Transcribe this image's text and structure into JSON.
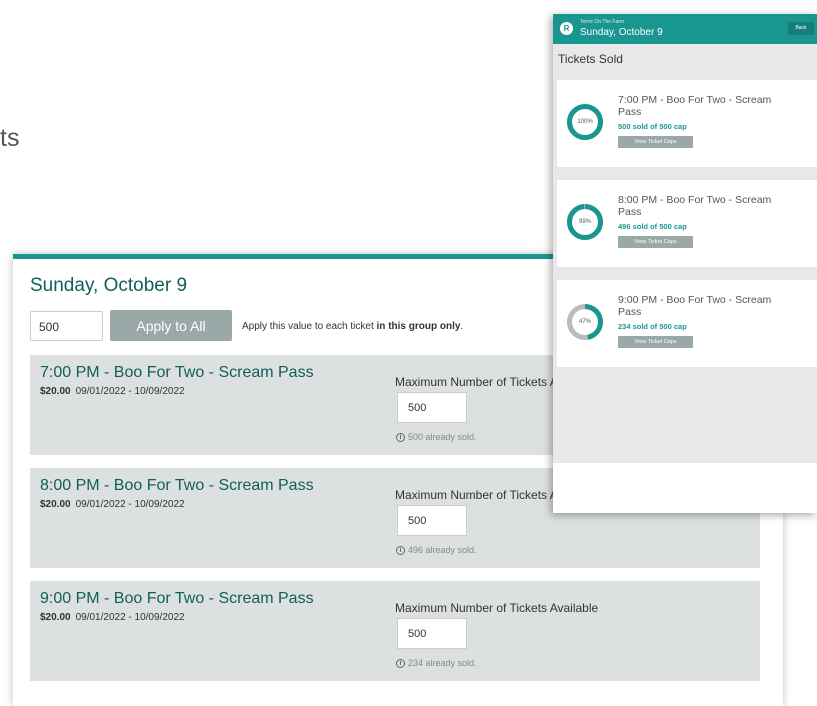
{
  "background_text": "ts",
  "desktop": {
    "title": "Sunday, October 9",
    "group_value": "500",
    "apply_label": "Apply to All",
    "apply_note_prefix": "Apply this value to each ticket ",
    "apply_note_bold": "in this group only",
    "apply_note_suffix": ".",
    "tickets": [
      {
        "name": "7:00 PM - Boo For Two - Scream Pass",
        "price": "$20.00",
        "dates": "09/01/2022 - 10/09/2022",
        "max_label": "Maximum Number of Tickets Available",
        "max_value": "500",
        "sold_note": "500 already sold."
      },
      {
        "name": "8:00 PM - Boo For Two - Scream Pass",
        "price": "$20.00",
        "dates": "09/01/2022 - 10/09/2022",
        "max_label": "Maximum Number of Tickets Available",
        "max_value": "500",
        "sold_note": "496 already sold."
      },
      {
        "name": "9:00 PM - Boo For Two - Scream Pass",
        "price": "$20.00",
        "dates": "09/01/2022 - 10/09/2022",
        "max_label": "Maximum Number of Tickets Available",
        "max_value": "500",
        "sold_note": "234 already sold."
      }
    ]
  },
  "mobile": {
    "logo_letter": "R",
    "subtitle": "Terror On The Farm",
    "title": "Sunday, October 9",
    "back_label": "Back",
    "section_title": "Tickets Sold",
    "cards": [
      {
        "percent": 100,
        "percent_label": "100%",
        "line1": "7:00 PM - Boo For Two - Scream",
        "line2": "Pass",
        "sold": "500 sold of 500 cap",
        "caps_label": "View Ticket Caps"
      },
      {
        "percent": 99,
        "percent_label": "99%",
        "line1": "8:00 PM - Boo For Two - Scream",
        "line2": "Pass",
        "sold": "496 sold of 500 cap",
        "caps_label": "View Ticket Caps"
      },
      {
        "percent": 47,
        "percent_label": "47%",
        "line1": "9:00 PM - Boo For Two - Scream",
        "line2": "Pass",
        "sold": "234 sold of 500 cap",
        "caps_label": "View Ticket Caps"
      }
    ]
  },
  "colors": {
    "accent": "#1a9690",
    "ring_track": "#b9bcbc",
    "button_gray": "#9aa9a8",
    "title_teal": "#0f5f5a"
  }
}
